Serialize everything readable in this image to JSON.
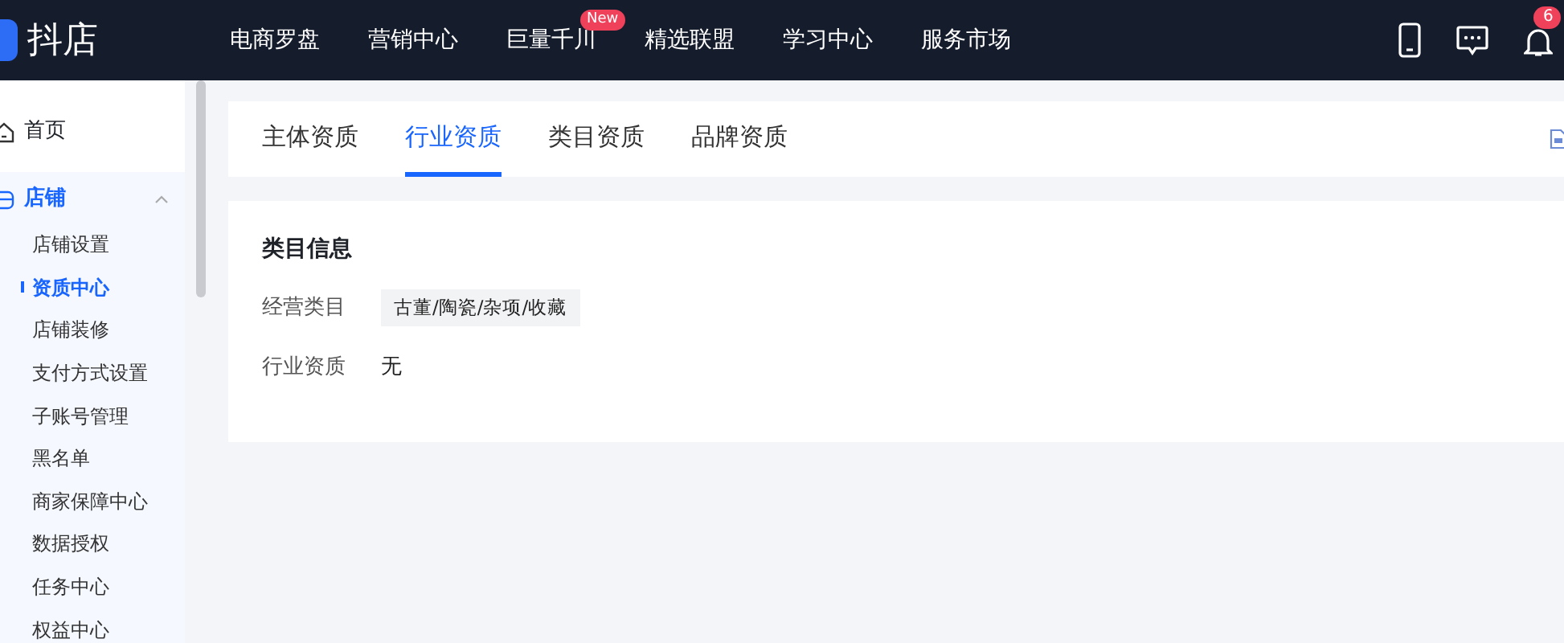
{
  "header": {
    "logo": "抖店",
    "nav": [
      {
        "label": "电商罗盘"
      },
      {
        "label": "营销中心"
      },
      {
        "label": "巨量千川",
        "badge": "New"
      },
      {
        "label": "精选联盟"
      },
      {
        "label": "学习中心"
      },
      {
        "label": "服务市场"
      }
    ],
    "notification_count": "6"
  },
  "sidebar": {
    "items": [
      {
        "label": "首页",
        "selected": false,
        "expanded": false
      },
      {
        "label": "店铺",
        "selected": true,
        "expanded": true,
        "children": [
          {
            "label": "店铺设置",
            "selected": false
          },
          {
            "label": "资质中心",
            "selected": true
          },
          {
            "label": "店铺装修",
            "selected": false
          },
          {
            "label": "支付方式设置",
            "selected": false
          },
          {
            "label": "子账号管理",
            "selected": false
          },
          {
            "label": "黑名单",
            "selected": false
          },
          {
            "label": "商家保障中心",
            "selected": false
          },
          {
            "label": "数据授权",
            "selected": false
          },
          {
            "label": "任务中心",
            "selected": false
          },
          {
            "label": "权益中心",
            "selected": false
          }
        ]
      }
    ]
  },
  "tabs": [
    {
      "label": "主体资质",
      "selected": false
    },
    {
      "label": "行业资质",
      "selected": true
    },
    {
      "label": "类目资质",
      "selected": false
    },
    {
      "label": "品牌资质",
      "selected": false
    }
  ],
  "section": {
    "title": "类目信息",
    "fields": [
      {
        "label": "经营类目",
        "value": "古董/陶瓷/杂项/收藏",
        "kind": "tag"
      },
      {
        "label": "行业资质",
        "value": "无",
        "kind": "text"
      }
    ]
  }
}
